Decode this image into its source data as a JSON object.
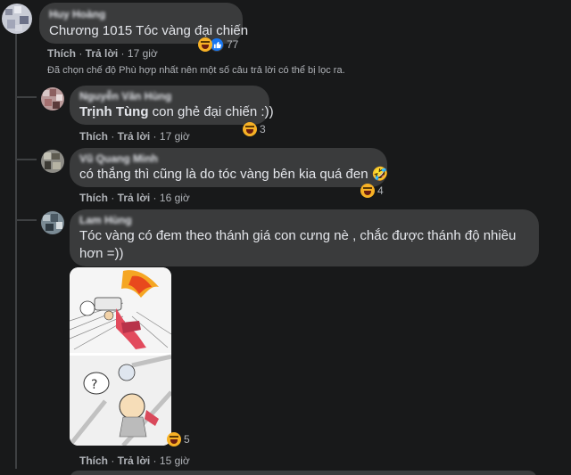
{
  "comments": [
    {
      "author": "Huy Hoàng",
      "text": "Chương 1015 Tóc vàng đại chiến",
      "like_label": "Thích",
      "reply_label": "Trả lời",
      "time": "17 giờ",
      "reaction_count": "77",
      "reaction_icons": [
        "haha-icon",
        "like-icon"
      ]
    },
    {
      "author": "Nguyễn Văn Hùng",
      "mention": "Trịnh Tùng",
      "text": " con ghẻ đại chiến :))",
      "like_label": "Thích",
      "reply_label": "Trả lời",
      "time": "17 giờ",
      "reaction_count": "3",
      "reaction_icons": [
        "haha-icon"
      ]
    },
    {
      "author": "Vũ Quang Minh",
      "text": "có thắng thì cũng là do tóc vàng bên kia quá đen 🤣",
      "like_label": "Thích",
      "reply_label": "Trả lời",
      "time": "16 giờ",
      "reaction_count": "4",
      "reaction_icons": [
        "haha-icon"
      ]
    },
    {
      "author": "Lam Hùng",
      "text": "Tóc vàng có đem theo thánh giá con cưng nè , chắc được thánh độ nhiều hơn =))",
      "like_label": "Thích",
      "reply_label": "Trả lời",
      "time": "15 giờ",
      "reaction_count": "5",
      "reaction_icons": [
        "haha-icon"
      ]
    }
  ],
  "filter_notice": "Đã chọn chế độ Phù hợp nhất nên một số câu trả lời có thể bị lọc ra.",
  "colors": {
    "background": "#18191a",
    "bubble": "#3a3b3c",
    "text": "#e4e6eb",
    "secondary_text": "#b0b3b8",
    "like_blue": "#1877f2",
    "haha_yellow": "#f7b125"
  }
}
